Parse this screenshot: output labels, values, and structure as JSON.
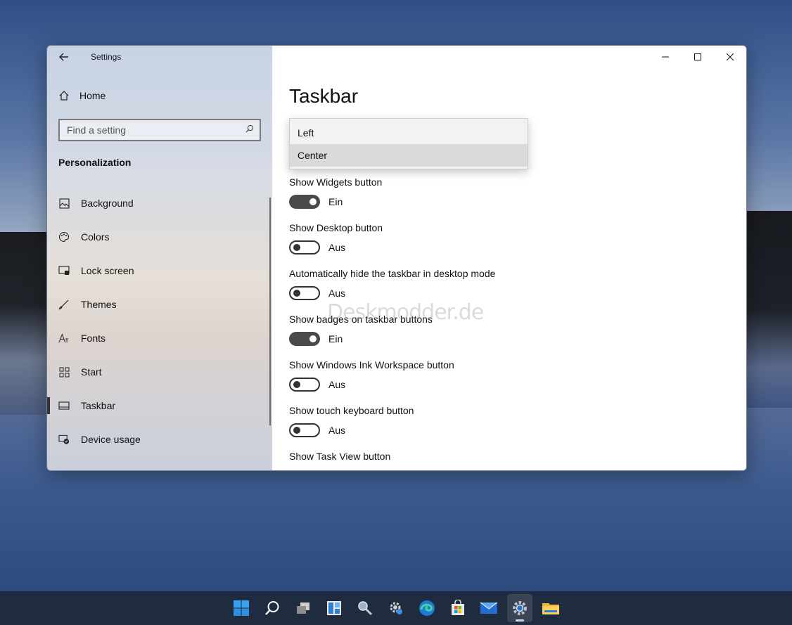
{
  "window": {
    "title": "Settings",
    "controls": [
      "minimize-icon",
      "maximize-icon",
      "close-icon"
    ]
  },
  "sidebar": {
    "home_label": "Home",
    "search_placeholder": "Find a setting",
    "section_title": "Personalization",
    "items": [
      {
        "label": "Background",
        "icon": "picture-icon"
      },
      {
        "label": "Colors",
        "icon": "palette-icon"
      },
      {
        "label": "Lock screen",
        "icon": "lock-screen-icon"
      },
      {
        "label": "Themes",
        "icon": "brush-icon"
      },
      {
        "label": "Fonts",
        "icon": "font-icon"
      },
      {
        "label": "Start",
        "icon": "start-grid-icon"
      },
      {
        "label": "Taskbar",
        "icon": "taskbar-icon",
        "active": true
      },
      {
        "label": "Device usage",
        "icon": "device-usage-icon"
      }
    ]
  },
  "main": {
    "page_title": "Taskbar",
    "dropdown": {
      "options": [
        "Left",
        "Center"
      ],
      "selected": "Center"
    },
    "settings": [
      {
        "label": "Show Widgets button",
        "state": "Ein",
        "on": true
      },
      {
        "label": "Show Desktop button",
        "state": "Aus",
        "on": false
      },
      {
        "label": "Automatically hide the taskbar in desktop mode",
        "state": "Aus",
        "on": false
      },
      {
        "label": "Show badges on taskbar buttons",
        "state": "Ein",
        "on": true
      },
      {
        "label": "Show Windows Ink Workspace button",
        "state": "Aus",
        "on": false
      },
      {
        "label": "Show touch keyboard button",
        "state": "Aus",
        "on": false
      },
      {
        "label": "Show Task View button"
      }
    ],
    "watermark": "Deskmodder.de"
  },
  "taskbar": {
    "icons": [
      "windows-start-icon",
      "search-icon",
      "task-view-icon",
      "widgets-icon",
      "magnifier-icon",
      "settings-gear-icon",
      "edge-browser-icon",
      "store-icon",
      "mail-icon",
      "settings-app-icon",
      "file-explorer-icon"
    ],
    "active_index": 9
  },
  "colors": {
    "accent_dark": "#4a4a4a",
    "taskbar_bg": "#1f2b3e"
  }
}
